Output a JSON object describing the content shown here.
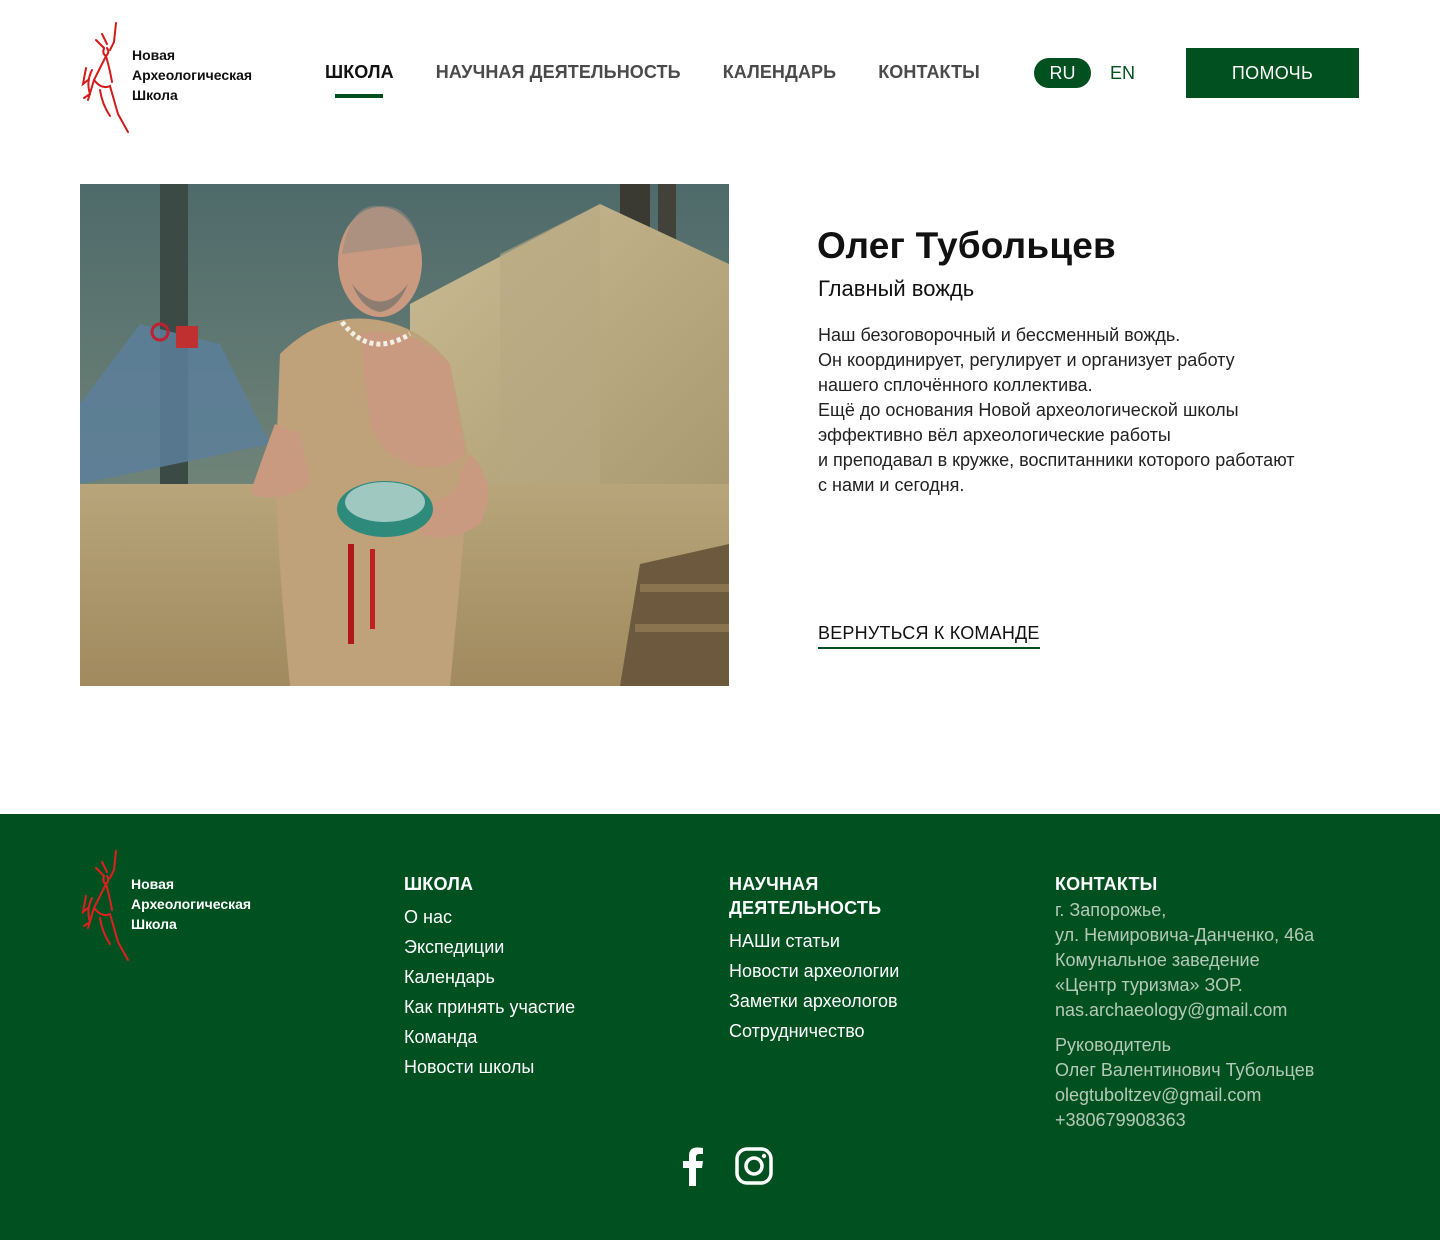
{
  "header": {
    "logo_lines": [
      "Новая",
      "Археологическая",
      "Школа"
    ],
    "nav": [
      {
        "label": "ШКОЛА",
        "active": true
      },
      {
        "label": "НАУЧНАЯ ДЕЯТЕЛЬНОСТЬ",
        "active": false
      },
      {
        "label": "КАЛЕНДАРЬ",
        "active": false
      },
      {
        "label": "КОНТАКТЫ",
        "active": false
      }
    ],
    "lang_ru": "RU",
    "lang_en": "EN",
    "help_button": "ПОМОЧЬ"
  },
  "profile": {
    "name": "Олег Тубольцев",
    "role": "Главный вождь",
    "bio": [
      "Наш безоговорочный и бессменный вождь.",
      "Он координирует, регулирует и организует работу",
      "нашего сплочённого коллектива.",
      "Ещё до основания Новой археологической школы",
      "эффективно вёл археологические работы",
      "и преподавал в кружке, воспитанники которого работают",
      "с нами и сегодня."
    ],
    "back_link": "ВЕРНУТЬСЯ К КОМАНДЕ"
  },
  "footer": {
    "logo_lines": [
      "Новая",
      "Археологическая",
      "Школа"
    ],
    "school": {
      "title": "ШКОЛА",
      "links": [
        "О нас",
        "Экспедиции",
        "Календарь",
        "Как принять участие",
        "Команда",
        "Новости школы"
      ]
    },
    "science": {
      "title_line1": "НАУЧНАЯ",
      "title_line2": "ДЕЯТЕЛЬНОСТЬ",
      "links": [
        "НАШи статьи",
        "Новости археологии",
        "Заметки археологов",
        "Сотрудничество"
      ]
    },
    "contacts": {
      "title": "КОНТАКТЫ",
      "address": [
        "г. Запорожье,",
        "ул. Немировича-Данченко, 46а",
        "Комунальное заведение",
        "«Центр туризма» ЗОР.",
        "nas.archaeology@gmail.com"
      ],
      "head": [
        "Руководитель",
        "Олег Валентинович Тубольцев",
        "olegtuboltzev@gmail.com",
        "+380679908363"
      ]
    },
    "social": [
      "facebook-icon",
      "instagram-icon"
    ]
  },
  "colors": {
    "brand_green": "#005020",
    "logo_red": "#d41a1a"
  }
}
